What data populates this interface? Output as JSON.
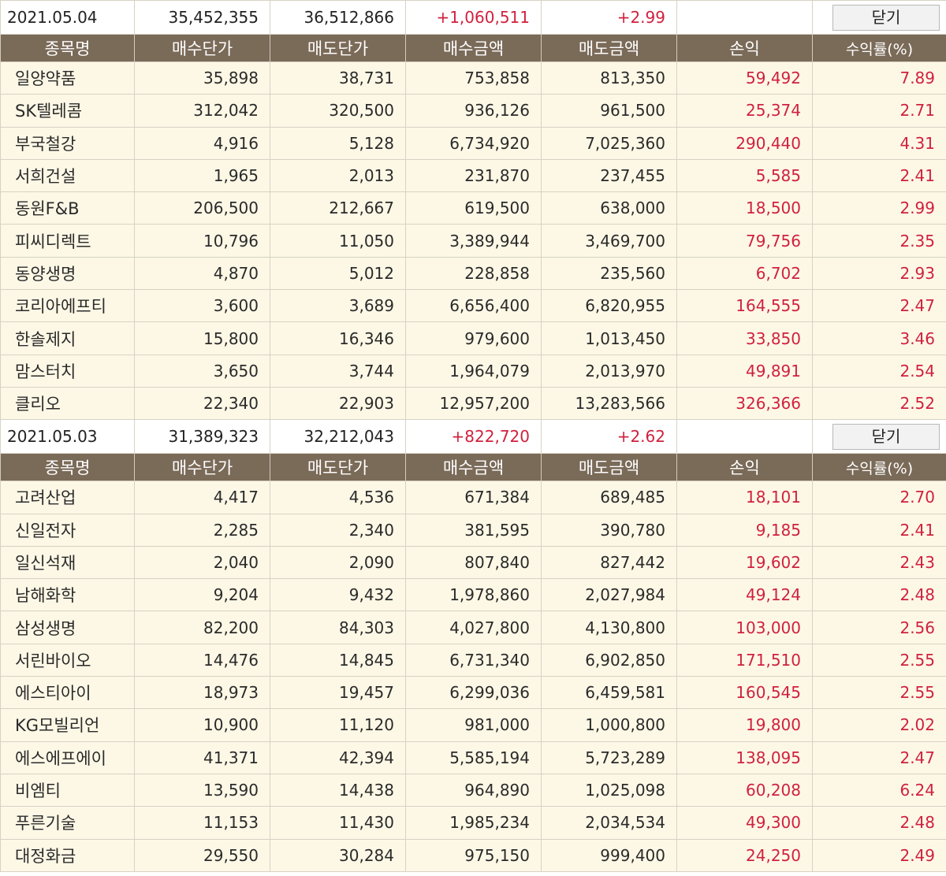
{
  "close_label": "닫기",
  "headers": [
    "종목명",
    "매수단가",
    "매도단가",
    "매수금액",
    "매도금액",
    "손익",
    "수익률(%)"
  ],
  "sections": [
    {
      "date": "2021.05.04",
      "total_buy": "35,452,355",
      "total_sell": "36,512,866",
      "profit": "+1,060,511",
      "rate": "+2.99",
      "rows": [
        [
          "일양약품",
          "35,898",
          "38,731",
          "753,858",
          "813,350",
          "59,492",
          "7.89"
        ],
        [
          "SK텔레콤",
          "312,042",
          "320,500",
          "936,126",
          "961,500",
          "25,374",
          "2.71"
        ],
        [
          "부국철강",
          "4,916",
          "5,128",
          "6,734,920",
          "7,025,360",
          "290,440",
          "4.31"
        ],
        [
          "서희건설",
          "1,965",
          "2,013",
          "231,870",
          "237,455",
          "5,585",
          "2.41"
        ],
        [
          "동원F&B",
          "206,500",
          "212,667",
          "619,500",
          "638,000",
          "18,500",
          "2.99"
        ],
        [
          "피씨디렉트",
          "10,796",
          "11,050",
          "3,389,944",
          "3,469,700",
          "79,756",
          "2.35"
        ],
        [
          "동양생명",
          "4,870",
          "5,012",
          "228,858",
          "235,560",
          "6,702",
          "2.93"
        ],
        [
          "코리아에프티",
          "3,600",
          "3,689",
          "6,656,400",
          "6,820,955",
          "164,555",
          "2.47"
        ],
        [
          "한솔제지",
          "15,800",
          "16,346",
          "979,600",
          "1,013,450",
          "33,850",
          "3.46"
        ],
        [
          "맘스터치",
          "3,650",
          "3,744",
          "1,964,079",
          "2,013,970",
          "49,891",
          "2.54"
        ],
        [
          "클리오",
          "22,340",
          "22,903",
          "12,957,200",
          "13,283,566",
          "326,366",
          "2.52"
        ]
      ]
    },
    {
      "date": "2021.05.03",
      "total_buy": "31,389,323",
      "total_sell": "32,212,043",
      "profit": "+822,720",
      "rate": "+2.62",
      "rows": [
        [
          "고려산업",
          "4,417",
          "4,536",
          "671,384",
          "689,485",
          "18,101",
          "2.70"
        ],
        [
          "신일전자",
          "2,285",
          "2,340",
          "381,595",
          "390,780",
          "9,185",
          "2.41"
        ],
        [
          "일신석재",
          "2,040",
          "2,090",
          "807,840",
          "827,442",
          "19,602",
          "2.43"
        ],
        [
          "남해화학",
          "9,204",
          "9,432",
          "1,978,860",
          "2,027,984",
          "49,124",
          "2.48"
        ],
        [
          "삼성생명",
          "82,200",
          "84,303",
          "4,027,800",
          "4,130,800",
          "103,000",
          "2.56"
        ],
        [
          "서린바이오",
          "14,476",
          "14,845",
          "6,731,340",
          "6,902,850",
          "171,510",
          "2.55"
        ],
        [
          "에스티아이",
          "18,973",
          "19,457",
          "6,299,036",
          "6,459,581",
          "160,545",
          "2.55"
        ],
        [
          "KG모빌리언",
          "10,900",
          "11,120",
          "981,000",
          "1,000,800",
          "19,800",
          "2.02"
        ],
        [
          "에스에프에이",
          "41,371",
          "42,394",
          "5,585,194",
          "5,723,289",
          "138,095",
          "2.47"
        ],
        [
          "비엠티",
          "13,590",
          "14,438",
          "964,890",
          "1,025,098",
          "60,208",
          "6.24"
        ],
        [
          "푸른기술",
          "11,153",
          "11,430",
          "1,985,234",
          "2,034,534",
          "49,300",
          "2.48"
        ],
        [
          "대정화금",
          "29,550",
          "30,284",
          "975,150",
          "999,400",
          "24,250",
          "2.49"
        ]
      ]
    }
  ]
}
